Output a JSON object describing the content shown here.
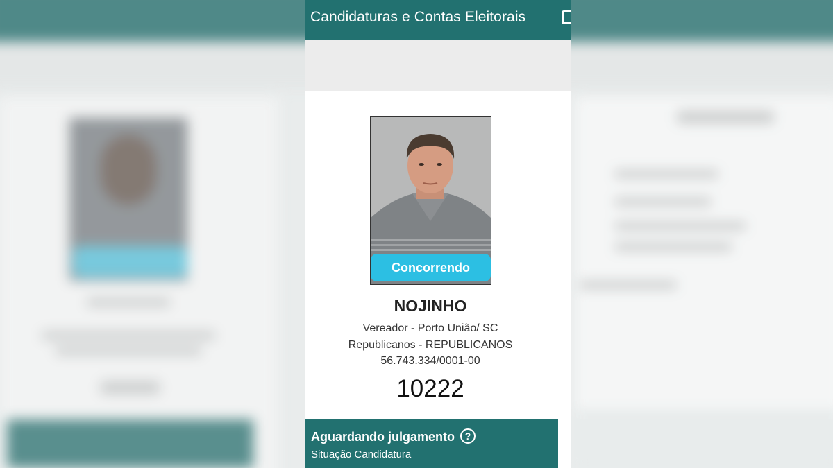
{
  "header": {
    "title": "Candidaturas e Contas Eleitorais"
  },
  "candidate": {
    "badge": "Concorrendo",
    "name": "NOJINHO",
    "office_location": "Vereador - Porto União/ SC",
    "party": "Republicanos - REPUBLICANOS",
    "cnpj": "56.743.334/0001-00",
    "number": "10222"
  },
  "status": {
    "title": "Aguardando julgamento",
    "help_icon": "?",
    "subtitle": "Situação Candidatura"
  },
  "colors": {
    "primary": "#227170",
    "badge": "#2cbfe3",
    "band": "#ececec"
  }
}
